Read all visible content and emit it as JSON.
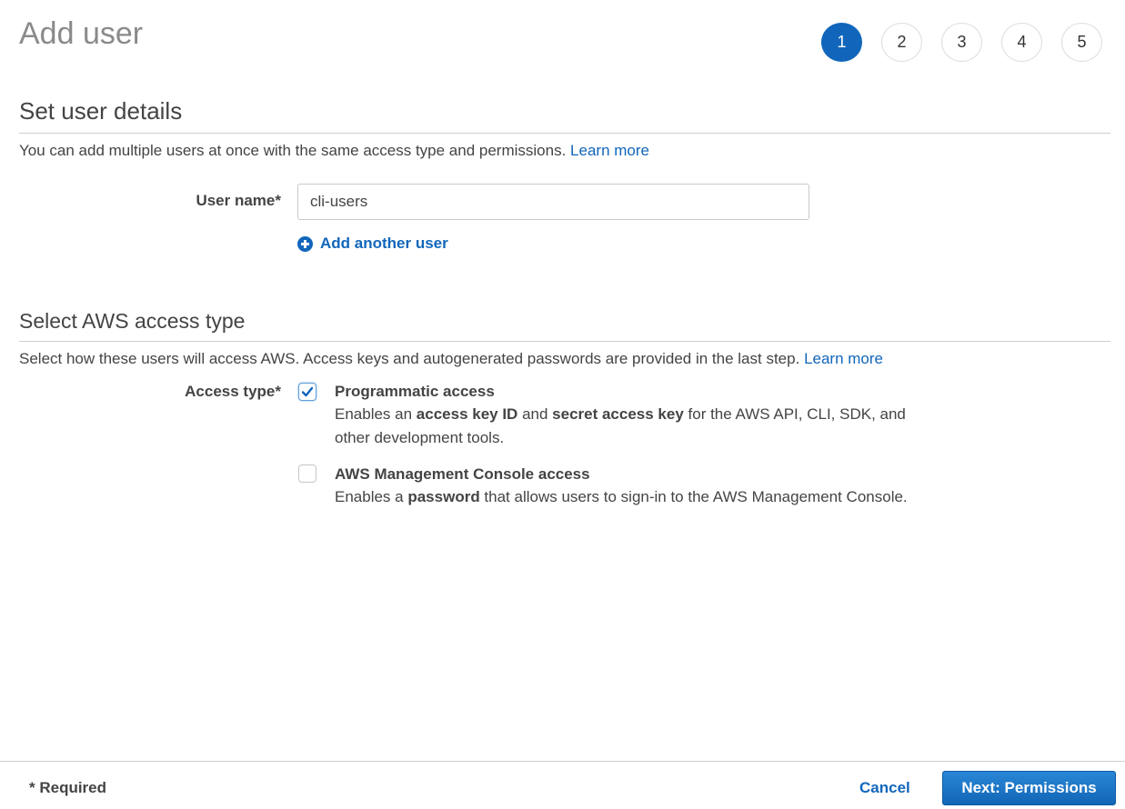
{
  "page": {
    "title": "Add user"
  },
  "steps": [
    {
      "label": "1",
      "active": true
    },
    {
      "label": "2",
      "active": false
    },
    {
      "label": "3",
      "active": false
    },
    {
      "label": "4",
      "active": false
    },
    {
      "label": "5",
      "active": false
    }
  ],
  "user_details": {
    "title": "Set user details",
    "description": "You can add multiple users at once with the same access type and permissions.",
    "learn_more": "Learn more",
    "user_name_label": "User name*",
    "user_name_value": "cli-users",
    "add_another_user": "Add another user"
  },
  "access_type": {
    "title": "Select AWS access type",
    "description": "Select how these users will access AWS. Access keys and autogenerated passwords are provided in the last step.",
    "learn_more": "Learn more",
    "label": "Access type*",
    "options": [
      {
        "title": "Programmatic access",
        "checked": true,
        "desc_parts": [
          "Enables an ",
          "access key ID",
          " and ",
          "secret access key",
          " for the AWS API, CLI, SDK, and other development tools."
        ]
      },
      {
        "title": "AWS Management Console access",
        "checked": false,
        "desc_parts": [
          "Enables a ",
          "password",
          " that allows users to sign-in to the AWS Management Console."
        ]
      }
    ]
  },
  "footer": {
    "required_note": "* Required",
    "cancel_label": "Cancel",
    "next_label": "Next: Permissions"
  },
  "colors": {
    "accent": "#1166bb",
    "text": "#444444",
    "title_gray": "#8a8a8a"
  }
}
